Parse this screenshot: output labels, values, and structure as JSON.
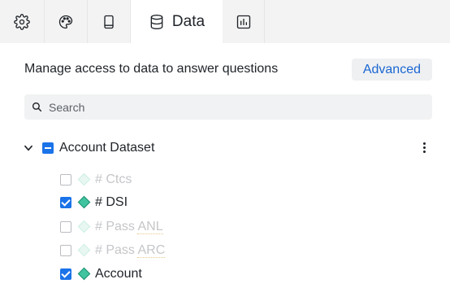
{
  "tabs": [
    {
      "name": "settings",
      "icon": "gear-icon",
      "label": ""
    },
    {
      "name": "appearance",
      "icon": "palette-icon",
      "label": ""
    },
    {
      "name": "guide",
      "icon": "book-icon",
      "label": ""
    },
    {
      "name": "data",
      "icon": "database-icon",
      "label": "Data",
      "active": true
    },
    {
      "name": "chart",
      "icon": "chart-icon",
      "label": ""
    }
  ],
  "header": {
    "text": "Manage access to data to answer questions",
    "advanced_label": "Advanced"
  },
  "search": {
    "placeholder": "Search",
    "value": ""
  },
  "tree": {
    "root": {
      "label": "Account Dataset",
      "state": "partial",
      "expanded": true
    },
    "fields": [
      {
        "prefix": "# ",
        "name": "Ctcs",
        "checked": false
      },
      {
        "prefix": "# ",
        "name": "DSI",
        "checked": true
      },
      {
        "prefix": "# ",
        "name": "Pass ",
        "name_underlined": "ANL",
        "checked": false
      },
      {
        "prefix": "# ",
        "name": "Pass ",
        "name_underlined": "ARC",
        "checked": false
      },
      {
        "prefix": "",
        "name": "Account",
        "checked": true
      }
    ]
  },
  "colors": {
    "accent": "#1a73e8",
    "link": "#1a66d2",
    "field_icon": "#40c4a0",
    "tabbar_bg": "#f3f3f3"
  }
}
